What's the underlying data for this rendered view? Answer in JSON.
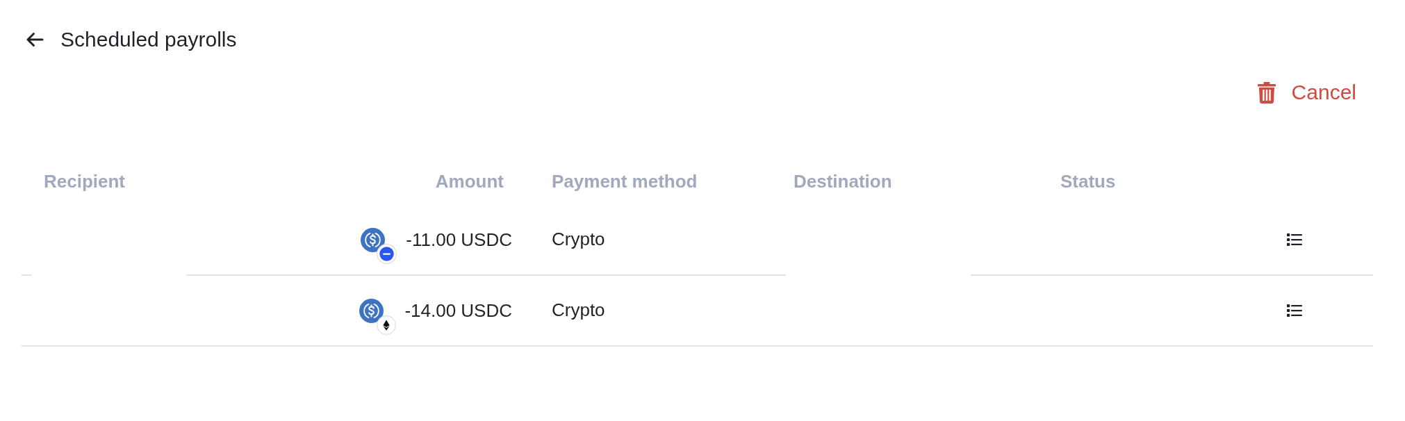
{
  "header": {
    "title": "Scheduled payrolls"
  },
  "actions": {
    "cancel": "Cancel"
  },
  "table": {
    "columns": [
      "Recipient",
      "Amount",
      "Payment method",
      "Destination",
      "Status"
    ],
    "rows": [
      {
        "amount": "-11.00 USDC",
        "badge": {
          "kind": "minus"
        },
        "payment_method": "Crypto"
      },
      {
        "amount": "-14.00 USDC",
        "badge": {
          "kind": "diamond"
        },
        "payment_method": "Crypto"
      }
    ]
  }
}
